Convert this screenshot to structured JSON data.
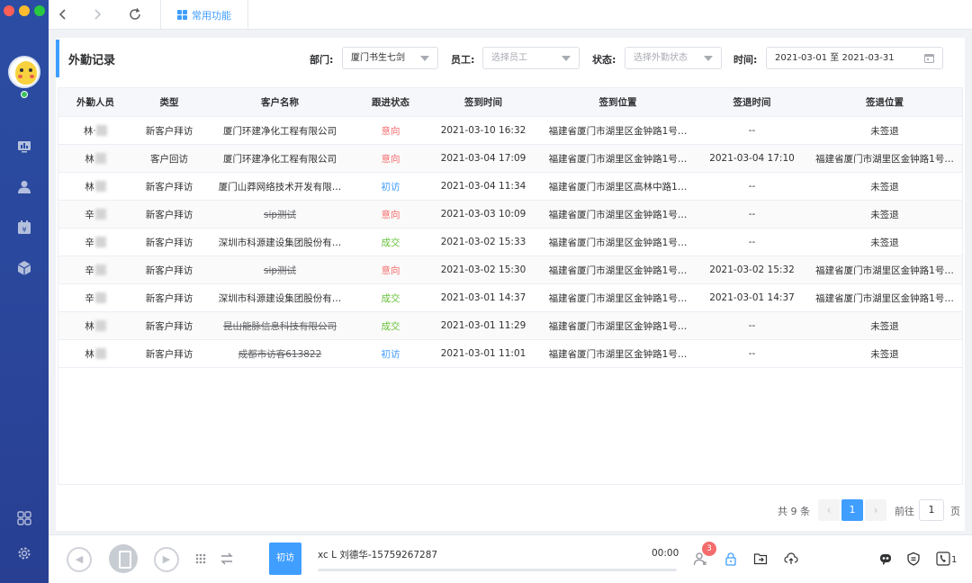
{
  "app": {
    "tab_common": "常用功能"
  },
  "page": {
    "title": "外勤记录"
  },
  "filters": {
    "dept_label": "部门:",
    "dept_value": "厦门书生七剑",
    "employee_label": "员工:",
    "employee_placeholder": "选择员工",
    "status_label": "状态:",
    "status_placeholder": "选择外勤状态",
    "time_label": "时间:",
    "time_value": "2021-03-01 至 2021-03-31"
  },
  "table": {
    "headers": [
      "外勤人员",
      "类型",
      "客户名称",
      "跟进状态",
      "签到时间",
      "签到位置",
      "签退时间",
      "签退位置"
    ],
    "rows": [
      {
        "person": "林ᐧ",
        "type": "新客户拜访",
        "customer": "厦门环建净化工程有限公司",
        "strike": false,
        "status": "意向",
        "status_kind": "intent",
        "checkin_time": "2021-03-10 16:32",
        "checkin_loc": "福建省厦门市湖里区金钟路1号…",
        "checkout_time": "--",
        "checkout_loc": "未签退"
      },
      {
        "person": "林",
        "type": "客户回访",
        "customer": "厦门环建净化工程有限公司",
        "strike": false,
        "status": "意向",
        "status_kind": "intent",
        "checkin_time": "2021-03-04 17:09",
        "checkin_loc": "福建省厦门市湖里区金钟路1号…",
        "checkout_time": "2021-03-04 17:10",
        "checkout_loc": "福建省厦门市湖里区金钟路1号…"
      },
      {
        "person": "林",
        "type": "新客户拜访",
        "customer": "厦门山莽网络技术开发有限…",
        "strike": false,
        "status": "初访",
        "status_kind": "first",
        "checkin_time": "2021-03-04 11:34",
        "checkin_loc": "福建省厦门市湖里区高林中路1…",
        "checkout_time": "--",
        "checkout_loc": "未签退"
      },
      {
        "person": "辛",
        "type": "新客户拜访",
        "customer": "sip测试",
        "strike": true,
        "status": "意向",
        "status_kind": "intent",
        "checkin_time": "2021-03-03 10:09",
        "checkin_loc": "福建省厦门市湖里区金钟路1号…",
        "checkout_time": "--",
        "checkout_loc": "未签退"
      },
      {
        "person": "辛",
        "type": "新客户拜访",
        "customer": "深圳市科源建设集团股份有…",
        "strike": false,
        "status": "成交",
        "status_kind": "deal",
        "checkin_time": "2021-03-02 15:33",
        "checkin_loc": "福建省厦门市湖里区金钟路1号…",
        "checkout_time": "--",
        "checkout_loc": "未签退"
      },
      {
        "person": "辛",
        "type": "新客户拜访",
        "customer": "sip测试",
        "strike": true,
        "status": "意向",
        "status_kind": "intent",
        "checkin_time": "2021-03-02 15:30",
        "checkin_loc": "福建省厦门市湖里区金钟路1号…",
        "checkout_time": "2021-03-02 15:32",
        "checkout_loc": "福建省厦门市湖里区金钟路1号…"
      },
      {
        "person": "辛",
        "type": "新客户拜访",
        "customer": "深圳市科源建设集团股份有…",
        "strike": false,
        "status": "成交",
        "status_kind": "deal",
        "checkin_time": "2021-03-01 14:37",
        "checkin_loc": "福建省厦门市湖里区金钟路1号…",
        "checkout_time": "2021-03-01 14:37",
        "checkout_loc": "福建省厦门市湖里区金钟路1号…"
      },
      {
        "person": "林",
        "type": "新客户拜访",
        "customer": "昆山能脉信息科技有限公司",
        "strike": true,
        "status": "成交",
        "status_kind": "deal",
        "checkin_time": "2021-03-01 11:29",
        "checkin_loc": "福建省厦门市湖里区金钟路1号…",
        "checkout_time": "--",
        "checkout_loc": "未签退"
      },
      {
        "person": "林",
        "type": "新客户拜访",
        "customer": "成都市访客613822",
        "strike": true,
        "status": "初访",
        "status_kind": "first",
        "checkin_time": "2021-03-01 11:01",
        "checkin_loc": "福建省厦门市湖里区金钟路1号…",
        "checkout_time": "--",
        "checkout_loc": "未签退"
      }
    ]
  },
  "pagination": {
    "total_text": "共 9 条",
    "current_page": "1",
    "goto_label": "前往",
    "goto_value": "1",
    "page_suffix": "页"
  },
  "callbar": {
    "tag": "初访",
    "caller": "xc L    刘德华-15759267287",
    "duration": "00:00",
    "notification_count": "3",
    "line_count": "1"
  },
  "colors": {
    "accent": "#409eff",
    "intent": "#f56c6c",
    "deal": "#67c23a",
    "sidebar": "#2b4da3"
  }
}
